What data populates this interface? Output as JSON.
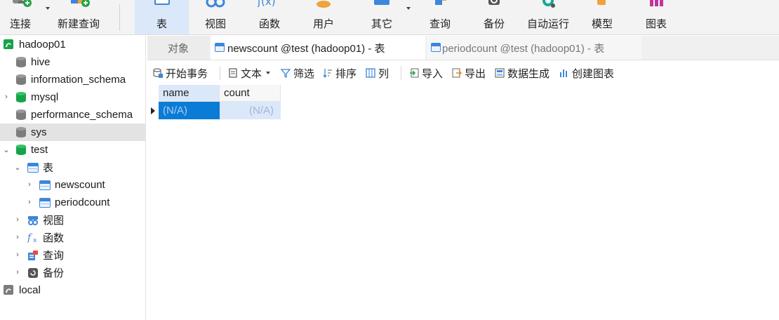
{
  "toolbar": {
    "connect": "连接",
    "new_query": "新建查询",
    "table": "表",
    "view": "视图",
    "function": "函数",
    "user": "用户",
    "others": "其它",
    "query": "查询",
    "backup": "备份",
    "automation": "自动运行",
    "model": "模型",
    "chart": "图表"
  },
  "sidebar": {
    "connection1": "hadoop01",
    "databases": [
      "hive",
      "information_schema",
      "mysql",
      "performance_schema",
      "sys",
      "test"
    ],
    "test_children": {
      "tables_group": "表",
      "tables": [
        "newscount",
        "periodcount"
      ],
      "views": "视图",
      "functions": "函数",
      "queries": "查询",
      "backups": "备份"
    },
    "connection2": "local"
  },
  "tabs": {
    "objects": "对象",
    "active": "newscount @test (hadoop01) - 表",
    "inactive": "periodcount @test (hadoop01) - 表"
  },
  "subtoolbar": {
    "begin_transaction": "开始事务",
    "text": "文本",
    "filter": "筛选",
    "sort": "排序",
    "columns": "列",
    "import": "导入",
    "export": "导出",
    "data_generation": "数据生成",
    "create_chart": "创建图表"
  },
  "grid": {
    "columns": [
      "name",
      "count"
    ],
    "rows": [
      [
        "(N/A)",
        "(N/A)"
      ]
    ]
  },
  "colors": {
    "accent": "#0a7cd6",
    "selected_tab_bg": "#dbe8fa",
    "db_active": "#16a34a",
    "db_inactive": "#7c7c7c"
  }
}
